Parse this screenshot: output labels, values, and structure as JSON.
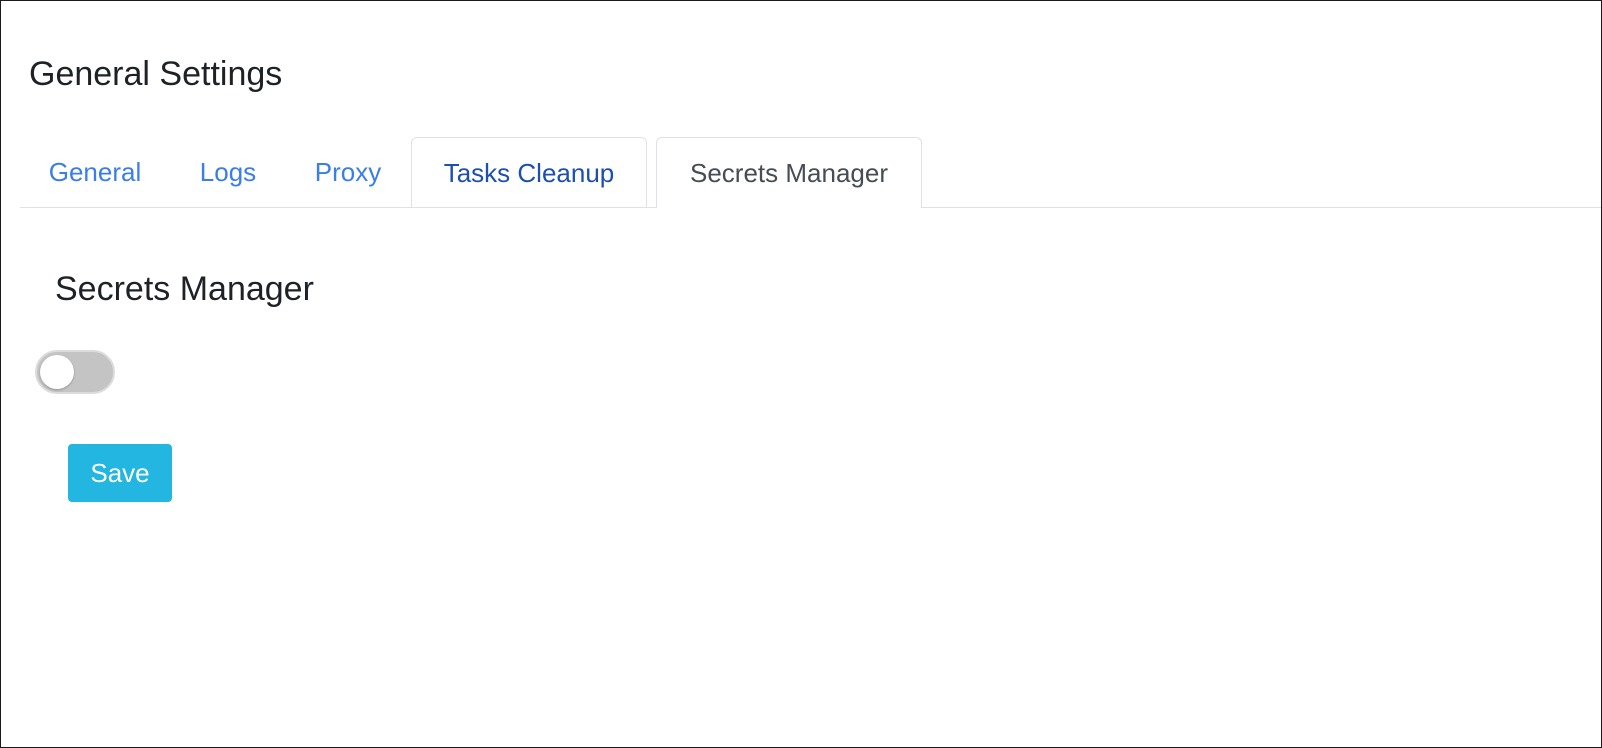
{
  "page": {
    "title": "General Settings"
  },
  "tabs": [
    {
      "label": "General",
      "state": "normal"
    },
    {
      "label": "Logs",
      "state": "normal"
    },
    {
      "label": "Proxy",
      "state": "normal"
    },
    {
      "label": "Tasks Cleanup",
      "state": "hover"
    },
    {
      "label": "Secrets Manager",
      "state": "active"
    }
  ],
  "section": {
    "title": "Secrets Manager",
    "toggle_enabled": false
  },
  "actions": {
    "save_label": "Save"
  },
  "colors": {
    "link": "#3a7ee8",
    "link_hover": "#1d4fae",
    "active_tab_text": "#474d54",
    "save_button": "#22b6e1",
    "toggle_off": "#c4c4c4"
  }
}
